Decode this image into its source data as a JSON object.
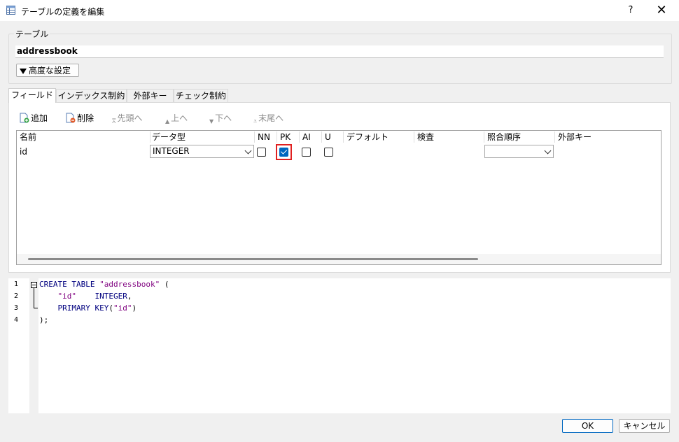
{
  "window": {
    "title": "テーブルの定義を編集",
    "help_label": "?",
    "close_label": "✕"
  },
  "table_group": {
    "label": "テーブル",
    "name_value": "addressbook",
    "advanced_label": "高度な設定"
  },
  "tabs": [
    {
      "label": "フィールド",
      "active": true
    },
    {
      "label": "インデックス制約",
      "active": false
    },
    {
      "label": "外部キー",
      "active": false
    },
    {
      "label": "チェック制約",
      "active": false
    }
  ],
  "toolbar": {
    "add": "追加",
    "delete": "削除",
    "first": "先頭へ",
    "up": "上へ",
    "down": "下へ",
    "last": "末尾へ"
  },
  "grid": {
    "columns": [
      "名前",
      "データ型",
      "NN",
      "PK",
      "AI",
      "U",
      "デフォルト",
      "検査",
      "照合順序",
      "外部キー"
    ],
    "rows": [
      {
        "name": "id",
        "type": "INTEGER",
        "nn": false,
        "pk": true,
        "ai": false,
        "u": false,
        "default": "",
        "check": "",
        "collation": "",
        "fk": ""
      }
    ]
  },
  "editor": {
    "line_numbers": [
      "1",
      "2",
      "3",
      "4"
    ],
    "lines": [
      {
        "kw1": "CREATE TABLE",
        "str1": "\"addressbook\"",
        "rest": " ("
      },
      {
        "indent": "    ",
        "str1": "\"id\"",
        "gap": "    ",
        "kw1": "INTEGER",
        "rest": ","
      },
      {
        "indent": "    ",
        "kw1": "PRIMARY KEY",
        "rest1": "(",
        "str1": "\"id\"",
        "rest": ")"
      },
      {
        "rest": ");"
      }
    ]
  },
  "buttons": {
    "ok": "OK",
    "cancel": "キャンセル"
  },
  "colors": {
    "accent": "#0067c0",
    "highlight": "#e02020",
    "keyword": "#00007f",
    "string": "#7f007f"
  }
}
